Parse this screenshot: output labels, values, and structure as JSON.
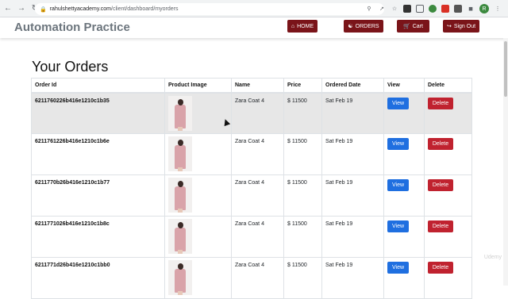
{
  "browser": {
    "url_host": "rahulshettyacademy.com",
    "url_path": "/client/dashboard/myorders",
    "profile_initial": "R"
  },
  "header": {
    "brand": "Automation Practice",
    "nav": [
      {
        "label": "HOME",
        "icon": "home-icon"
      },
      {
        "label": "ORDERS",
        "icon": "handshake-icon"
      },
      {
        "label": "Cart",
        "icon": "cart-icon"
      },
      {
        "label": "Sign Out",
        "icon": "sign-out-icon"
      }
    ],
    "nav_color": "#7a1419"
  },
  "main": {
    "title": "Your Orders",
    "columns": [
      "Order Id",
      "Product Image",
      "Name",
      "Price",
      "Ordered Date",
      "View",
      "Delete"
    ],
    "rows": [
      {
        "order_id": "6211760226b416e1210c1b35",
        "name": "Zara Coat 4",
        "price": "$ 11500",
        "date": "Sat Feb 19",
        "view": "View",
        "delete": "Delete"
      },
      {
        "order_id": "6211761226b416e1210c1b6e",
        "name": "Zara Coat 4",
        "price": "$ 11500",
        "date": "Sat Feb 19",
        "view": "View",
        "delete": "Delete"
      },
      {
        "order_id": "6211770b26b416e1210c1b77",
        "name": "Zara Coat 4",
        "price": "$ 11500",
        "date": "Sat Feb 19",
        "view": "View",
        "delete": "Delete"
      },
      {
        "order_id": "6211771026b416e1210c1b8c",
        "name": "Zara Coat 4",
        "price": "$ 11500",
        "date": "Sat Feb 19",
        "view": "View",
        "delete": "Delete"
      },
      {
        "order_id": "6211771d26b416e1210c1bb0",
        "name": "Zara Coat 4",
        "price": "$ 11500",
        "date": "Sat Feb 19",
        "view": "View",
        "delete": "Delete"
      }
    ],
    "view_color": "#1f6fe0",
    "delete_color": "#c0222f"
  },
  "watermark": "Udemy"
}
